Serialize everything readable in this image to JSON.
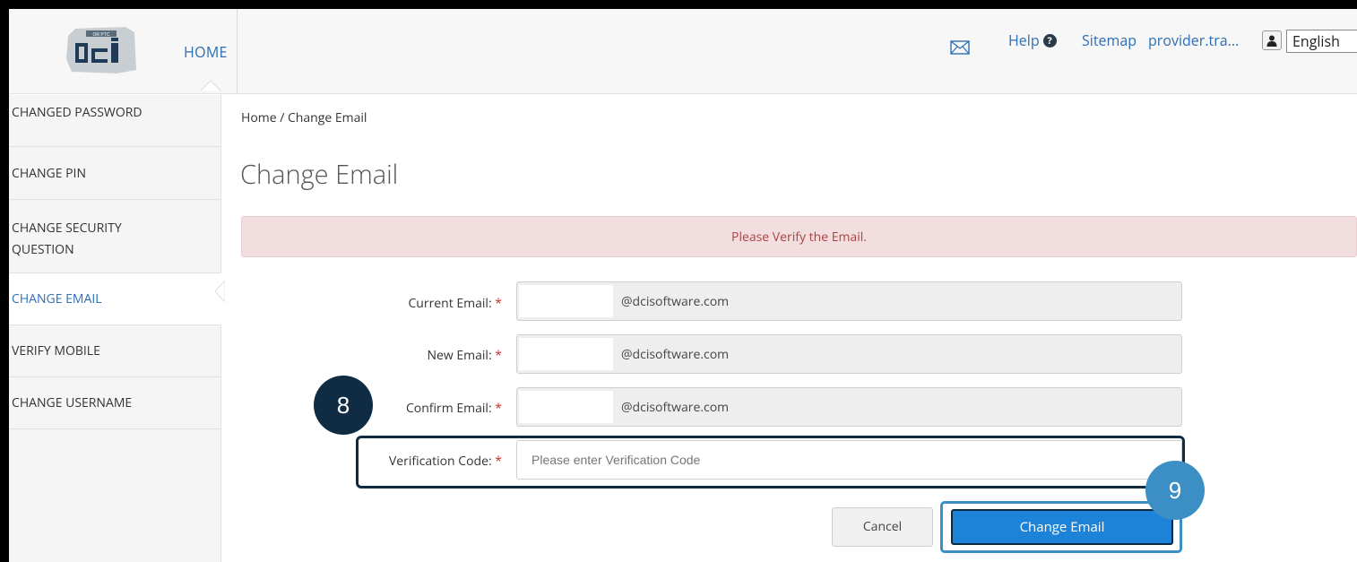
{
  "header": {
    "logo_caption": "OR PTC",
    "logo_text": "DCI",
    "home_label": "HOME",
    "help_label": "Help",
    "sitemap_label": "Sitemap",
    "user_label": "provider.tra...",
    "language": "English"
  },
  "sidebar": {
    "items": [
      {
        "label": "CHANGED PASSWORD"
      },
      {
        "label": "CHANGE PIN"
      },
      {
        "label": "CHANGE SECURITY QUESTION"
      },
      {
        "label": "CHANGE EMAIL"
      },
      {
        "label": "VERIFY MOBILE"
      },
      {
        "label": "CHANGE USERNAME"
      }
    ],
    "active_index": 3
  },
  "main": {
    "breadcrumb": "Home / Change Email",
    "title": "Change Email",
    "alert": "Please Verify the Email.",
    "fields": {
      "current": {
        "label": "Current Email:",
        "required": "*",
        "domain": "@dcisoftware.com"
      },
      "new": {
        "label": "New Email:",
        "required": "*",
        "domain": "@dcisoftware.com"
      },
      "confirm": {
        "label": "Confirm Email:",
        "required": "*",
        "domain": "@dcisoftware.com"
      },
      "verification": {
        "label": "Verification Code:",
        "required": "*",
        "placeholder": "Please enter Verification Code",
        "value": ""
      }
    },
    "buttons": {
      "cancel": "Cancel",
      "submit": "Change Email"
    }
  },
  "callouts": {
    "step_8": "8",
    "step_9": "9"
  },
  "colors": {
    "link": "#2c6fb5",
    "alert_bg": "#f2dede",
    "alert_text": "#a94442",
    "primary_button": "#1c83d8",
    "callout_dark": "#102c44",
    "callout_light": "#3c8fc4"
  }
}
